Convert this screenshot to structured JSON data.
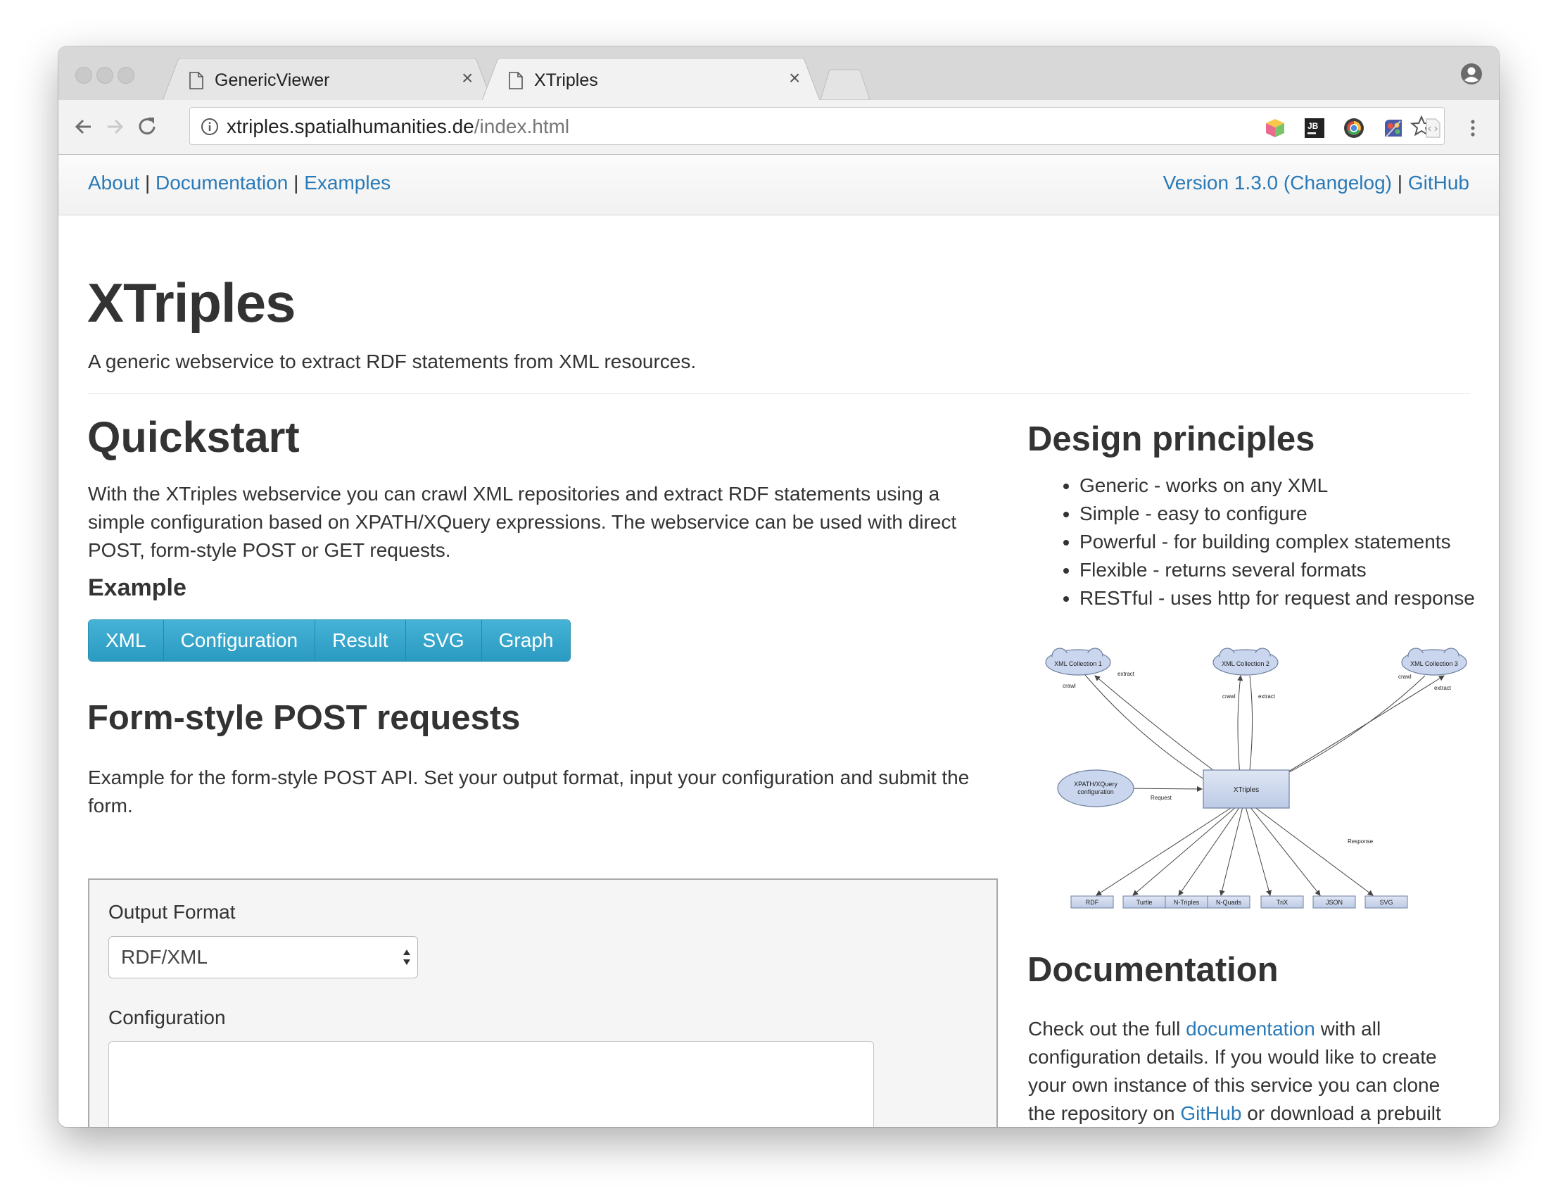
{
  "browser": {
    "tabs": [
      {
        "title": "GenericViewer"
      },
      {
        "title": "XTriples",
        "active": true
      }
    ],
    "url": {
      "host": "xtriples.spatialhumanities.de",
      "path": "/index.html"
    },
    "extension_icons": [
      "cube-extension-icon",
      "jb-extension-icon",
      "chrome-extension-icon",
      "palette-extension-icon",
      "document-extension-icon"
    ]
  },
  "navbar": {
    "left": [
      "About",
      "Documentation",
      "Examples"
    ],
    "right": [
      "Version 1.3.0 (Changelog)",
      "GitHub"
    ],
    "separator": "|"
  },
  "header": {
    "title": "XTriples",
    "tagline": "A generic webservice to extract RDF statements from XML resources."
  },
  "quickstart": {
    "heading": "Quickstart",
    "lines": [
      "With the XTriples webservice you can crawl XML repositories and extract RDF statements using a",
      "simple configuration based on XPATH/XQuery expressions. The webservice can be used with direct",
      "POST, form-style POST or GET requests."
    ],
    "example_heading": "Example",
    "example_buttons": [
      "XML",
      "Configuration",
      "Result",
      "SVG",
      "Graph"
    ]
  },
  "form_post": {
    "heading": "Form-style POST requests",
    "lines": [
      "Example for the form-style POST API. Set your output format, input your configuration and submit the",
      "form."
    ],
    "output_format_label": "Output Format",
    "output_format_value": "RDF/XML",
    "configuration_label": "Configuration"
  },
  "design": {
    "heading": "Design principles",
    "items": [
      "Generic - works on any XML",
      "Simple - easy to configure",
      "Powerful - for building complex statements",
      "Flexible - returns several formats",
      "RESTful - uses http for request and response"
    ]
  },
  "diagram": {
    "collections": [
      "XML Collection 1",
      "XML Collection 2",
      "XML Collection 3"
    ],
    "config": [
      "XPATH/XQuery",
      "configuration"
    ],
    "center": "XTriples",
    "edge_labels": {
      "crawl": "crawl",
      "extract": "extract",
      "request": "Request",
      "response": "Response"
    },
    "outputs": [
      "RDF",
      "Turtle",
      "N-Triples",
      "N-Quads",
      "TriX",
      "JSON",
      "SVG"
    ]
  },
  "documentation": {
    "heading": "Documentation",
    "line1_pre": "Check out the full ",
    "line1_link": "documentation",
    "line1_post": " with all",
    "line2": "configuration details. If you would like to create",
    "line3": "your own instance of this service you can clone",
    "line4_pre": "the repository on ",
    "line4_link": "GitHub",
    "line4_post": " or download a prebuilt"
  }
}
